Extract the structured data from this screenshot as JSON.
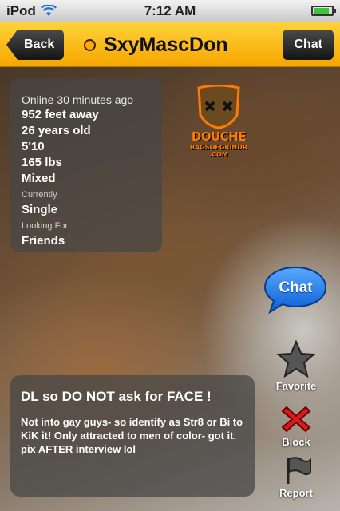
{
  "status_bar": {
    "carrier": "iPod",
    "time": "7:12 AM",
    "battery_level": 0.85,
    "wifi_icon": "wifi-icon",
    "battery_icon": "battery-icon"
  },
  "nav": {
    "back_label": "Back",
    "title": "SxyMascDon",
    "chat_label": "Chat",
    "online_dot_color": "#ffa800"
  },
  "profile": {
    "online": "Online 30 minutes ago",
    "distance": "952 feet away",
    "age": "26 years old",
    "height": "5'10",
    "weight": "165 lbs",
    "ethnicity": "Mixed",
    "currently_label": "Currently",
    "currently_value": "Single",
    "looking_label": "Looking For",
    "looking_value": "Friends"
  },
  "watermark": {
    "line1": "DOUCHE",
    "line2": "BAGSOFGRINDR",
    "line3": ".COM"
  },
  "actions": {
    "chat_label": "Chat",
    "favorite_label": "Favorite",
    "block_label": "Block",
    "report_label": "Report"
  },
  "bio": {
    "headline": "DL so DO NOT ask for FACE !",
    "body": "Not into gay guys- so identify as Str8 or Bi to KiK it!  Only attracted to men of color- got it. pix AFTER interview lol"
  },
  "colors": {
    "nav_gradient_top": "#ffd23a",
    "nav_gradient_bottom": "#f6a600",
    "chat_bubble": "#1f7bea",
    "block_red": "#d81b1b"
  }
}
